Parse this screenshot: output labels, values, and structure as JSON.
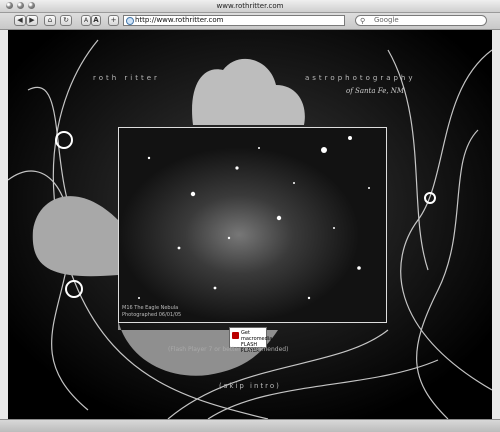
{
  "window": {
    "title": "www.rothritter.com"
  },
  "toolbar": {
    "back_label": "◀",
    "forward_label": "▶",
    "home_label": "⌂",
    "reload_label": "↻",
    "text_smaller_label": "A",
    "text_bigger_label": "A",
    "add_bookmark_label": "+",
    "url": "http://www.rothritter.com",
    "search_placeholder": "Google"
  },
  "page": {
    "brand_left": "roth ritter",
    "brand_right": "astrophotography",
    "brand_sub": "of Santa Fe, NM",
    "caption_line1": "M16 The Eagle Nebula",
    "caption_line2": "Photographed 06/01/05",
    "flash_badge_line1": "Get macromedia",
    "flash_badge_line2": "FLASH",
    "flash_badge_line3": "PLAYER",
    "flash_note": "(Flash Player 7 or better recommended)",
    "skip_intro": "(skip intro)"
  }
}
